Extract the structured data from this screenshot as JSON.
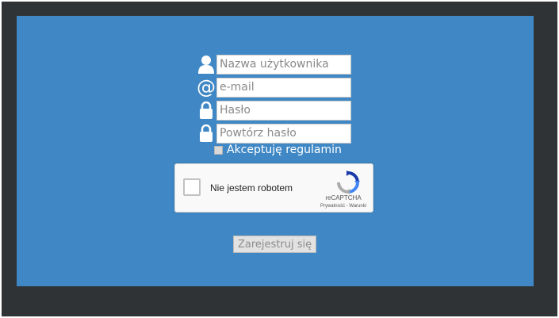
{
  "form": {
    "username": {
      "placeholder": "Nazwa użytkownika",
      "icon": "user-icon"
    },
    "email": {
      "placeholder": "e-mail",
      "icon": "at-icon",
      "glyph": "@"
    },
    "password": {
      "placeholder": "Hasło",
      "icon": "lock-icon"
    },
    "password_repeat": {
      "placeholder": "Powtórz hasło",
      "icon": "lock-icon"
    },
    "terms_label": "Akceptuję regulamin",
    "submit_label": "Zarejestruj się"
  },
  "captcha": {
    "label": "Nie jestem robotem",
    "brand": "reCAPTCHA",
    "links": "Prywatność - Warunki"
  },
  "colors": {
    "panel": "#3f88c5",
    "frame": "#2f3336"
  }
}
